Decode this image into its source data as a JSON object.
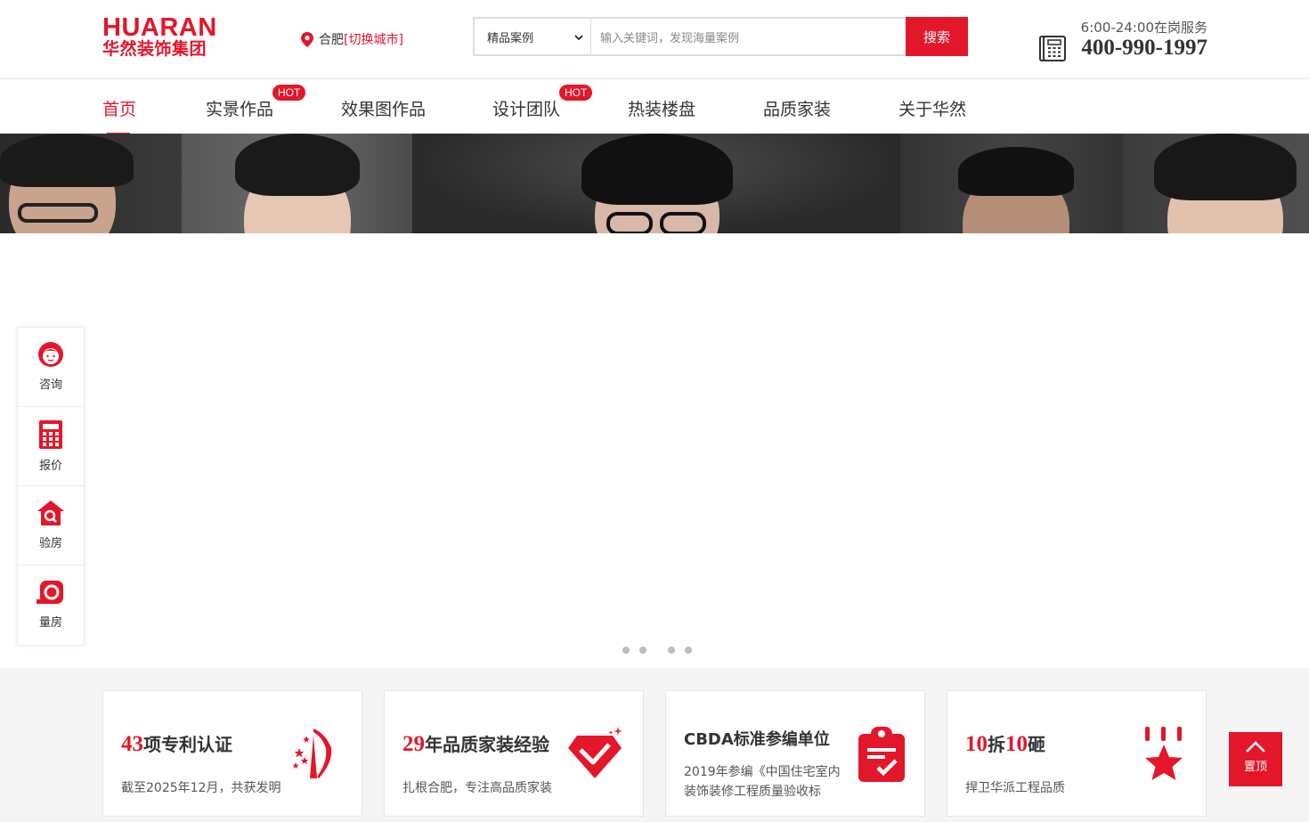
{
  "brand": {
    "logo_en": "HUARAN",
    "logo_cn": "华然装饰集团",
    "accent": "#e4162a"
  },
  "city": {
    "name": "合肥",
    "switch_label": "[切换城市]"
  },
  "search": {
    "category_selected": "精品案例",
    "placeholder": "输入关键词，发现海量案例",
    "button_label": "搜索"
  },
  "hotline": {
    "hours": "6:00-24:00在岗服务",
    "number": "400-990-1997"
  },
  "nav": {
    "items": [
      {
        "label": "首页"
      },
      {
        "label": "实景作品",
        "badge": "HOT"
      },
      {
        "label": "效果图作品"
      },
      {
        "label": "设计团队",
        "badge": "HOT"
      },
      {
        "label": "热装楼盘"
      },
      {
        "label": "品质家装"
      },
      {
        "label": "关于华然"
      }
    ]
  },
  "sidebar": {
    "items": [
      {
        "label": "咨询",
        "icon": "consultant-icon"
      },
      {
        "label": "报价",
        "icon": "calculator-icon"
      },
      {
        "label": "验房",
        "icon": "house-inspect-icon"
      },
      {
        "label": "量房",
        "icon": "tape-measure-icon"
      }
    ]
  },
  "features": [
    {
      "number": "43",
      "title_rest": "项专利认证",
      "desc": "截至2025年12月，共获发明",
      "icon": "patent-icon"
    },
    {
      "number": "29",
      "title_rest": "年品质家装经验",
      "desc": "扎根合肥，专注高品质家装",
      "icon": "diamond-check-icon"
    },
    {
      "number": "",
      "title_rest": "CBDA标准参编单位",
      "desc": "2019年参编《中国住宅室内装饰装修工程质量验收标",
      "icon": "clipboard-check-icon"
    },
    {
      "number": "10",
      "title_mid": "拆",
      "number2": "10",
      "title_rest": "砸",
      "desc": "捍卫华派工程品质",
      "icon": "star-medal-icon"
    }
  ],
  "back_to_top": {
    "label": "置顶"
  }
}
